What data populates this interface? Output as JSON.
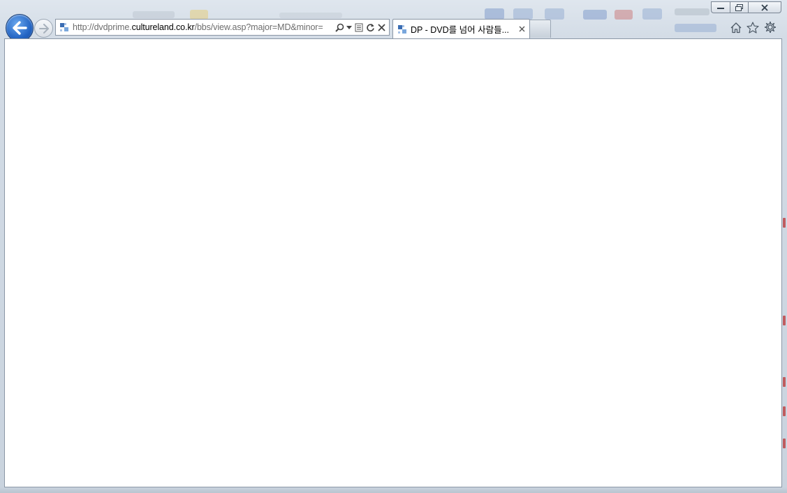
{
  "browser": {
    "address_bar": {
      "url_prefix": "http://dvdprime.",
      "url_host": "cultureland.co.kr",
      "url_path": "/bbs/view.asp?major=MD&minor="
    },
    "tab": {
      "title": "DP - DVD를 넘어 사람들..."
    },
    "icons": {
      "back": "arrow-left-icon",
      "forward": "arrow-right-icon",
      "search": "magnifier-icon",
      "dropdown": "chevron-down-icon",
      "compat": "compatibility-view-icon",
      "refresh": "refresh-icon",
      "stop": "close-icon",
      "home": "home-icon",
      "favorites": "star-icon",
      "tools": "gear-icon"
    },
    "colors": {
      "back_button": "#2465c4",
      "chrome": "#d3dce6",
      "content_bg": "#ffffff"
    }
  }
}
